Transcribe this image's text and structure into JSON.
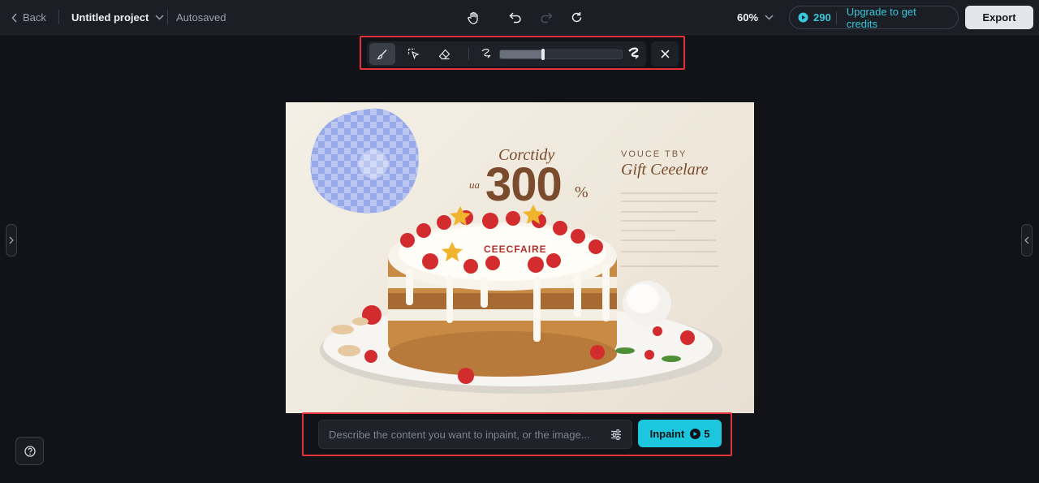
{
  "header": {
    "back_label": "Back",
    "project_title": "Untitled project",
    "autosave_status": "Autosaved",
    "zoom_level": "60%",
    "credits": "290",
    "upgrade_label": "Upgrade to get credits",
    "export_label": "Export"
  },
  "inpaint_toolbar": {
    "tools": [
      "brush-icon",
      "select-icon",
      "eraser-icon"
    ],
    "active_tool": "brush-icon",
    "brush_size_fraction": 0.35
  },
  "canvas_text": {
    "line1": "Corctidy",
    "prefix": "ua",
    "number": "300",
    "percent": "%",
    "voucher_top": "VOUCE TBY",
    "voucher_title": "Gift Ceeelare",
    "cake_label": "CEECFAIRE"
  },
  "prompt": {
    "placeholder": "Describe the content you want to inpaint, or the image...",
    "button_label": "Inpaint",
    "cost": "5"
  },
  "colors": {
    "accent": "#1cc7dd",
    "highlight_box": "#e2333a",
    "background": "#111318"
  }
}
